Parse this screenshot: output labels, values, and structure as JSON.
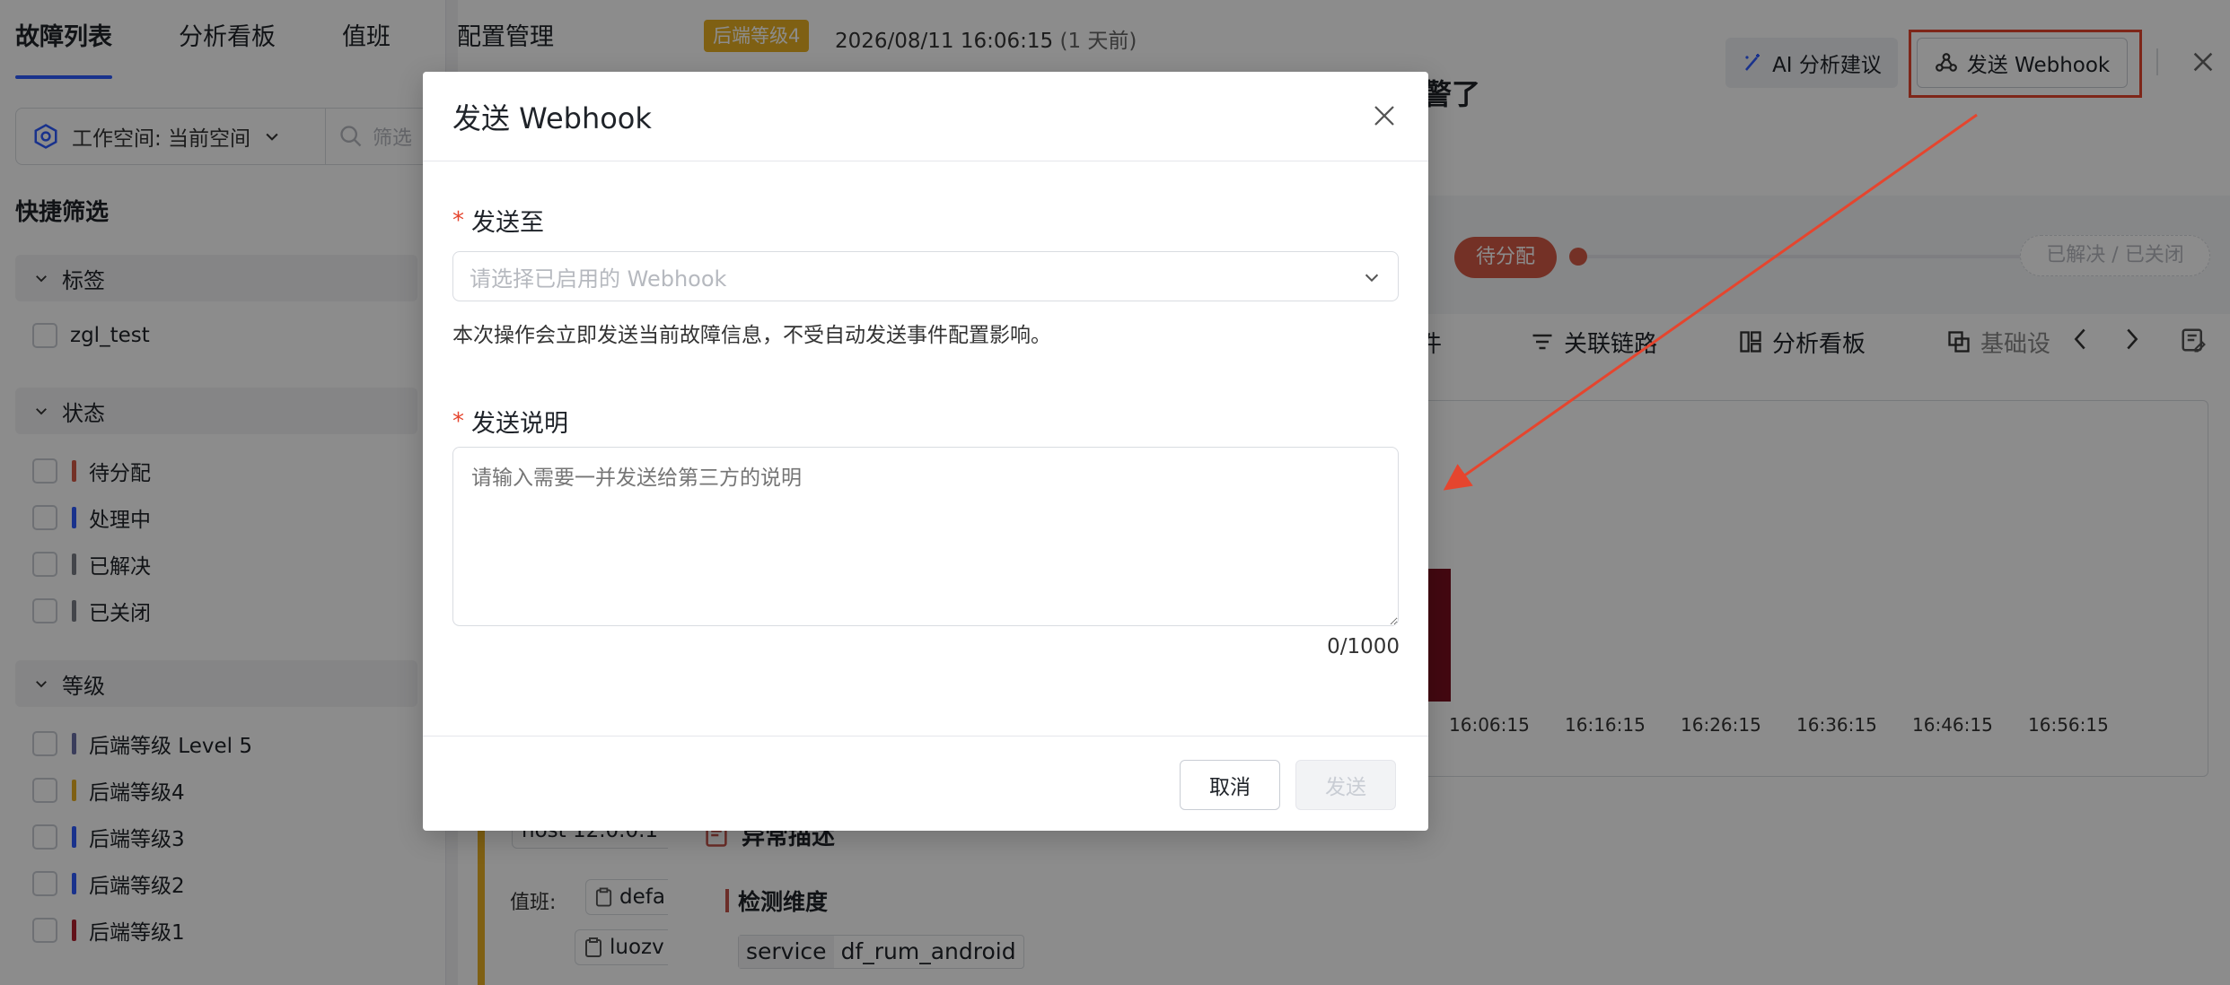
{
  "nav": {
    "tabs": [
      "故障列表",
      "分析看板",
      "值班",
      "配置管理"
    ]
  },
  "filters": {
    "workspace_label": "工作空间: 当前空间",
    "search_placeholder": "筛选",
    "quick_title": "快捷筛选",
    "groups": [
      {
        "title": "标签",
        "items": [
          {
            "label": "zgl_test",
            "color": ""
          }
        ]
      },
      {
        "title": "状态",
        "items": [
          {
            "label": "待分配",
            "color": "#d35a46"
          },
          {
            "label": "处理中",
            "color": "#2e5bff"
          },
          {
            "label": "已解决",
            "color": "#7a7f87"
          },
          {
            "label": "已关闭",
            "color": "#7a7f87"
          }
        ]
      },
      {
        "title": "等级",
        "items": [
          {
            "label": "后端等级 Level 5",
            "color": "#6b6fa6"
          },
          {
            "label": "后端等级4",
            "color": "#e8b023"
          },
          {
            "label": "后端等级3",
            "color": "#2e5bff"
          },
          {
            "label": "后端等级2",
            "color": "#2e5bff"
          },
          {
            "label": "后端等级1",
            "color": "#b3202f"
          }
        ]
      }
    ]
  },
  "detail": {
    "level_badge": "后端等级4",
    "timestamp": "2026/08/11 16:06:15",
    "relative": "(1 天前)",
    "title_fragment": "警了",
    "ai_button": "AI 分析建议",
    "webhook_button": "发送 Webhook",
    "status_pending": "待分配",
    "status_done": "已解决 / 已关闭",
    "tabs": [
      "件",
      "关联链路",
      "分析看板",
      "基础设"
    ],
    "abnormal_title": "异常描述",
    "dimension_label": "检测维度",
    "dimension_tag_key": "service",
    "dimension_tag_value": "df_rum_android",
    "duty_label": "值班:",
    "duty_chips": [
      "defa",
      "luozv"
    ],
    "host_chip": "host 12.0.0.1"
  },
  "chart_data": {
    "type": "bar",
    "categories": [
      "16:06:15",
      "16:16:15",
      "16:26:15",
      "16:36:15",
      "16:46:15",
      "16:56:15"
    ],
    "values": [
      1,
      0,
      0,
      0,
      0,
      0
    ]
  },
  "modal": {
    "title": "发送 Webhook",
    "send_to_label": "发送至",
    "required_mark": "*",
    "select_placeholder": "请选择已启用的 Webhook",
    "hint": "本次操作会立即发送当前故障信息，不受自动发送事件配置影响。",
    "note_label": "发送说明",
    "note_placeholder": "请输入需要一并发送给第三方的说明",
    "counter": "0/1000",
    "cancel": "取消",
    "send": "发送"
  },
  "colors": {
    "accent": "#2e5bff",
    "annotation": "#e5452e"
  }
}
